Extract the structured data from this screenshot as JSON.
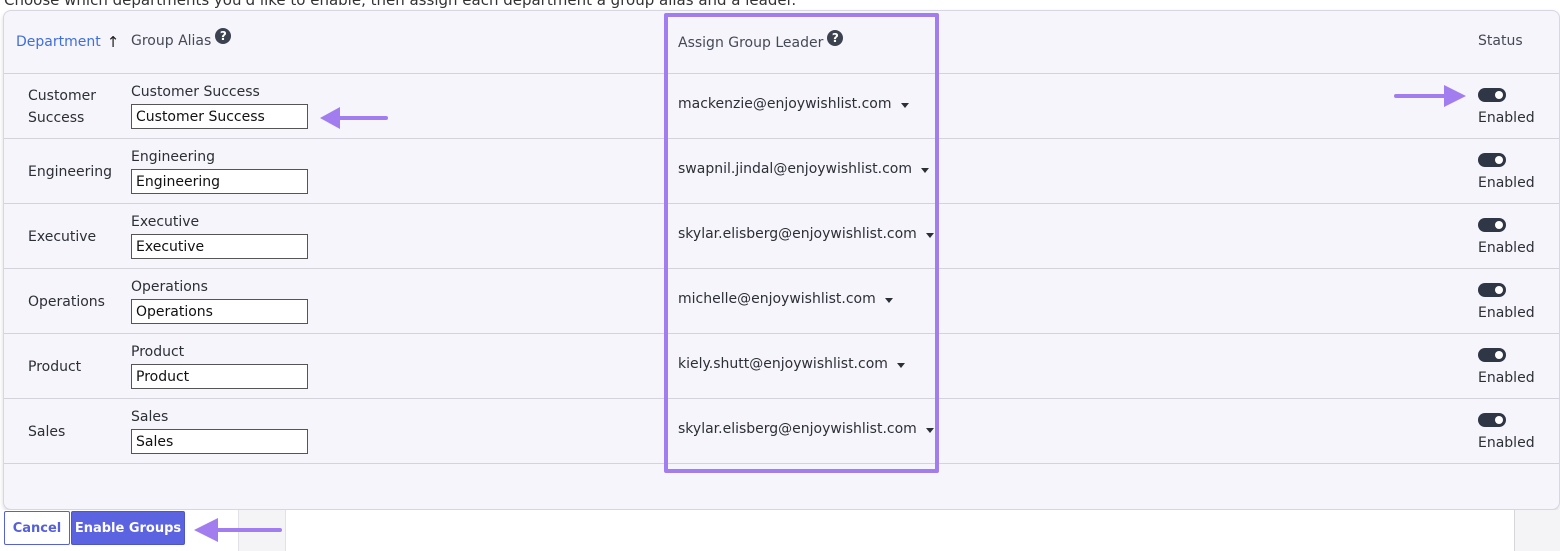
{
  "caption": "Choose which departments you'd like to enable, then assign each department a group alias and a leader.",
  "columns": {
    "department": "Department",
    "department_sort": "↑",
    "group_alias": "Group Alias",
    "assign_leader": "Assign Group Leader",
    "status": "Status",
    "help_glyph": "?"
  },
  "rows": [
    {
      "department": "Customer Success",
      "alias_label": "Customer Success",
      "alias_value": "Customer Success",
      "leader": "mackenzie@enjoywishlist.com",
      "status": "Enabled"
    },
    {
      "department": "Engineering",
      "alias_label": "Engineering",
      "alias_value": "Engineering",
      "leader": "swapnil.jindal@enjoywishlist.com",
      "status": "Enabled"
    },
    {
      "department": "Executive",
      "alias_label": "Executive",
      "alias_value": "Executive",
      "leader": "skylar.elisberg@enjoywishlist.com",
      "status": "Enabled"
    },
    {
      "department": "Operations",
      "alias_label": "Operations",
      "alias_value": "Operations",
      "leader": "michelle@enjoywishlist.com",
      "status": "Enabled"
    },
    {
      "department": "Product",
      "alias_label": "Product",
      "alias_value": "Product",
      "leader": "kiely.shutt@enjoywishlist.com",
      "status": "Enabled"
    },
    {
      "department": "Sales",
      "alias_label": "Sales",
      "alias_value": "Sales",
      "leader": "skylar.elisberg@enjoywishlist.com",
      "status": "Enabled"
    }
  ],
  "footer": {
    "cancel_label": "Cancel",
    "enable_label": "Enable Groups"
  },
  "colors": {
    "accent": "#5b63e0",
    "highlight": "#a27df0",
    "toggle_on": "#2f3646",
    "link": "#3f6fd8"
  }
}
